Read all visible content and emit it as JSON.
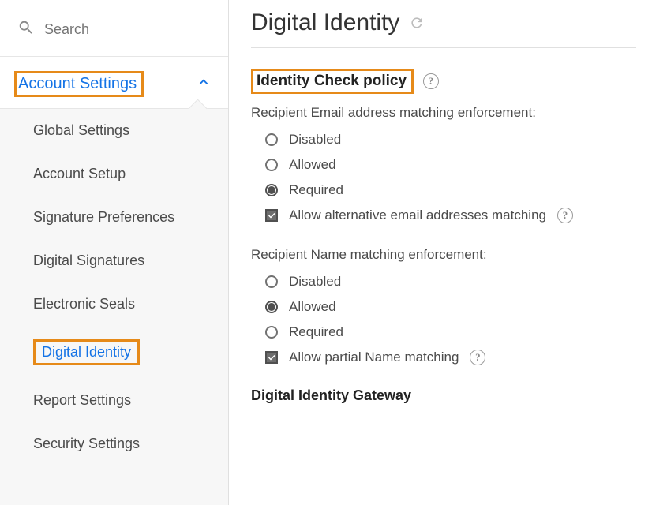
{
  "sidebar": {
    "search_placeholder": "Search",
    "section_label": "Account Settings",
    "items": [
      {
        "label": "Global Settings",
        "active": false
      },
      {
        "label": "Account Setup",
        "active": false
      },
      {
        "label": "Signature Preferences",
        "active": false
      },
      {
        "label": "Digital Signatures",
        "active": false
      },
      {
        "label": "Electronic Seals",
        "active": false
      },
      {
        "label": "Digital Identity",
        "active": true
      },
      {
        "label": "Report Settings",
        "active": false
      },
      {
        "label": "Security Settings",
        "active": false
      }
    ]
  },
  "main": {
    "page_title": "Digital Identity",
    "policy_title": "Identity Check policy",
    "email_group_label": "Recipient Email address matching enforcement:",
    "email_options": [
      {
        "label": "Disabled",
        "selected": false
      },
      {
        "label": "Allowed",
        "selected": false
      },
      {
        "label": "Required",
        "selected": true
      }
    ],
    "email_alt_checkbox": {
      "label": "Allow alternative email addresses matching",
      "checked": true
    },
    "name_group_label": "Recipient Name matching enforcement:",
    "name_options": [
      {
        "label": "Disabled",
        "selected": false
      },
      {
        "label": "Allowed",
        "selected": true
      },
      {
        "label": "Required",
        "selected": false
      }
    ],
    "name_partial_checkbox": {
      "label": "Allow partial Name matching",
      "checked": true
    },
    "gateway_title": "Digital Identity Gateway"
  },
  "highlight_color": "#e68a19"
}
